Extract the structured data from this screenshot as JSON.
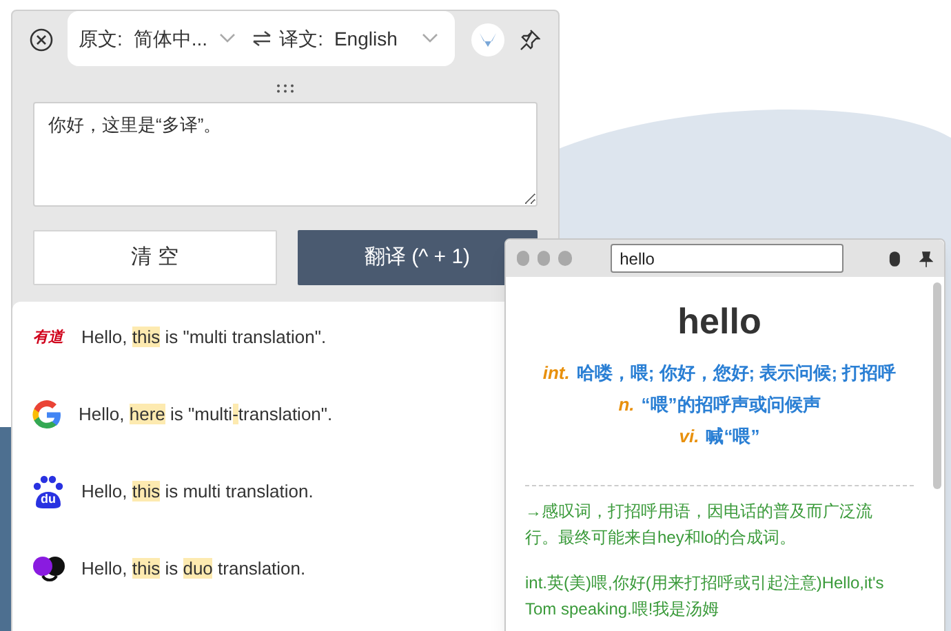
{
  "translator_window": {
    "language_bar": {
      "source_label": "原文:",
      "source_value": "简体中...",
      "target_label": "译文:",
      "target_value": "English"
    },
    "input": {
      "value": "你好，这里是“多译”。"
    },
    "buttons": [
      {
        "kind": "clear",
        "label": "清 空"
      },
      {
        "kind": "translate",
        "label": "翻译 (^ + 1)"
      }
    ],
    "results": [
      {
        "kind": "youdao",
        "logo_text": "有道",
        "segments": [
          {
            "text": "Hello, ",
            "highlighted": false
          },
          {
            "text": "this",
            "highlighted": true
          },
          {
            "text": " is \"multi translation\".",
            "highlighted": false
          }
        ]
      },
      {
        "kind": "google",
        "segments": [
          {
            "text": "Hello, ",
            "highlighted": false
          },
          {
            "text": "here",
            "highlighted": true
          },
          {
            "text": " is \"multi",
            "highlighted": false
          },
          {
            "text": "-",
            "highlighted": true
          },
          {
            "text": "translation\".",
            "highlighted": false
          }
        ]
      },
      {
        "kind": "baidu",
        "logo_text": "du",
        "segments": [
          {
            "text": "Hello, ",
            "highlighted": false
          },
          {
            "text": "this",
            "highlighted": true
          },
          {
            "text": " is multi translation.",
            "highlighted": false
          }
        ]
      },
      {
        "kind": "duo",
        "segments": [
          {
            "text": "Hello, ",
            "highlighted": false
          },
          {
            "text": "this",
            "highlighted": true
          },
          {
            "text": " is ",
            "highlighted": false
          },
          {
            "text": "duo",
            "highlighted": true
          },
          {
            "text": " translation.",
            "highlighted": false
          }
        ]
      }
    ]
  },
  "dictionary_window": {
    "search": {
      "value": "hello"
    },
    "headword": "hello",
    "definitions": [
      {
        "pos": "int.",
        "meaning": "哈喽，喂; 你好，您好; 表示问候; 打招呼"
      },
      {
        "pos": "n.",
        "meaning": "“喂”的招呼声或问候声"
      },
      {
        "pos": "vi.",
        "meaning": "喊“喂”"
      }
    ],
    "notes": [
      "→感叹词，打招呼用语，因电话的普及而广泛流行。最终可能来自hey和lo的合成词。",
      "int.英(美)喂,你好(用来打招呼或引起注意)Hello,it's Tom speaking.喂!我是汤姆"
    ]
  }
}
